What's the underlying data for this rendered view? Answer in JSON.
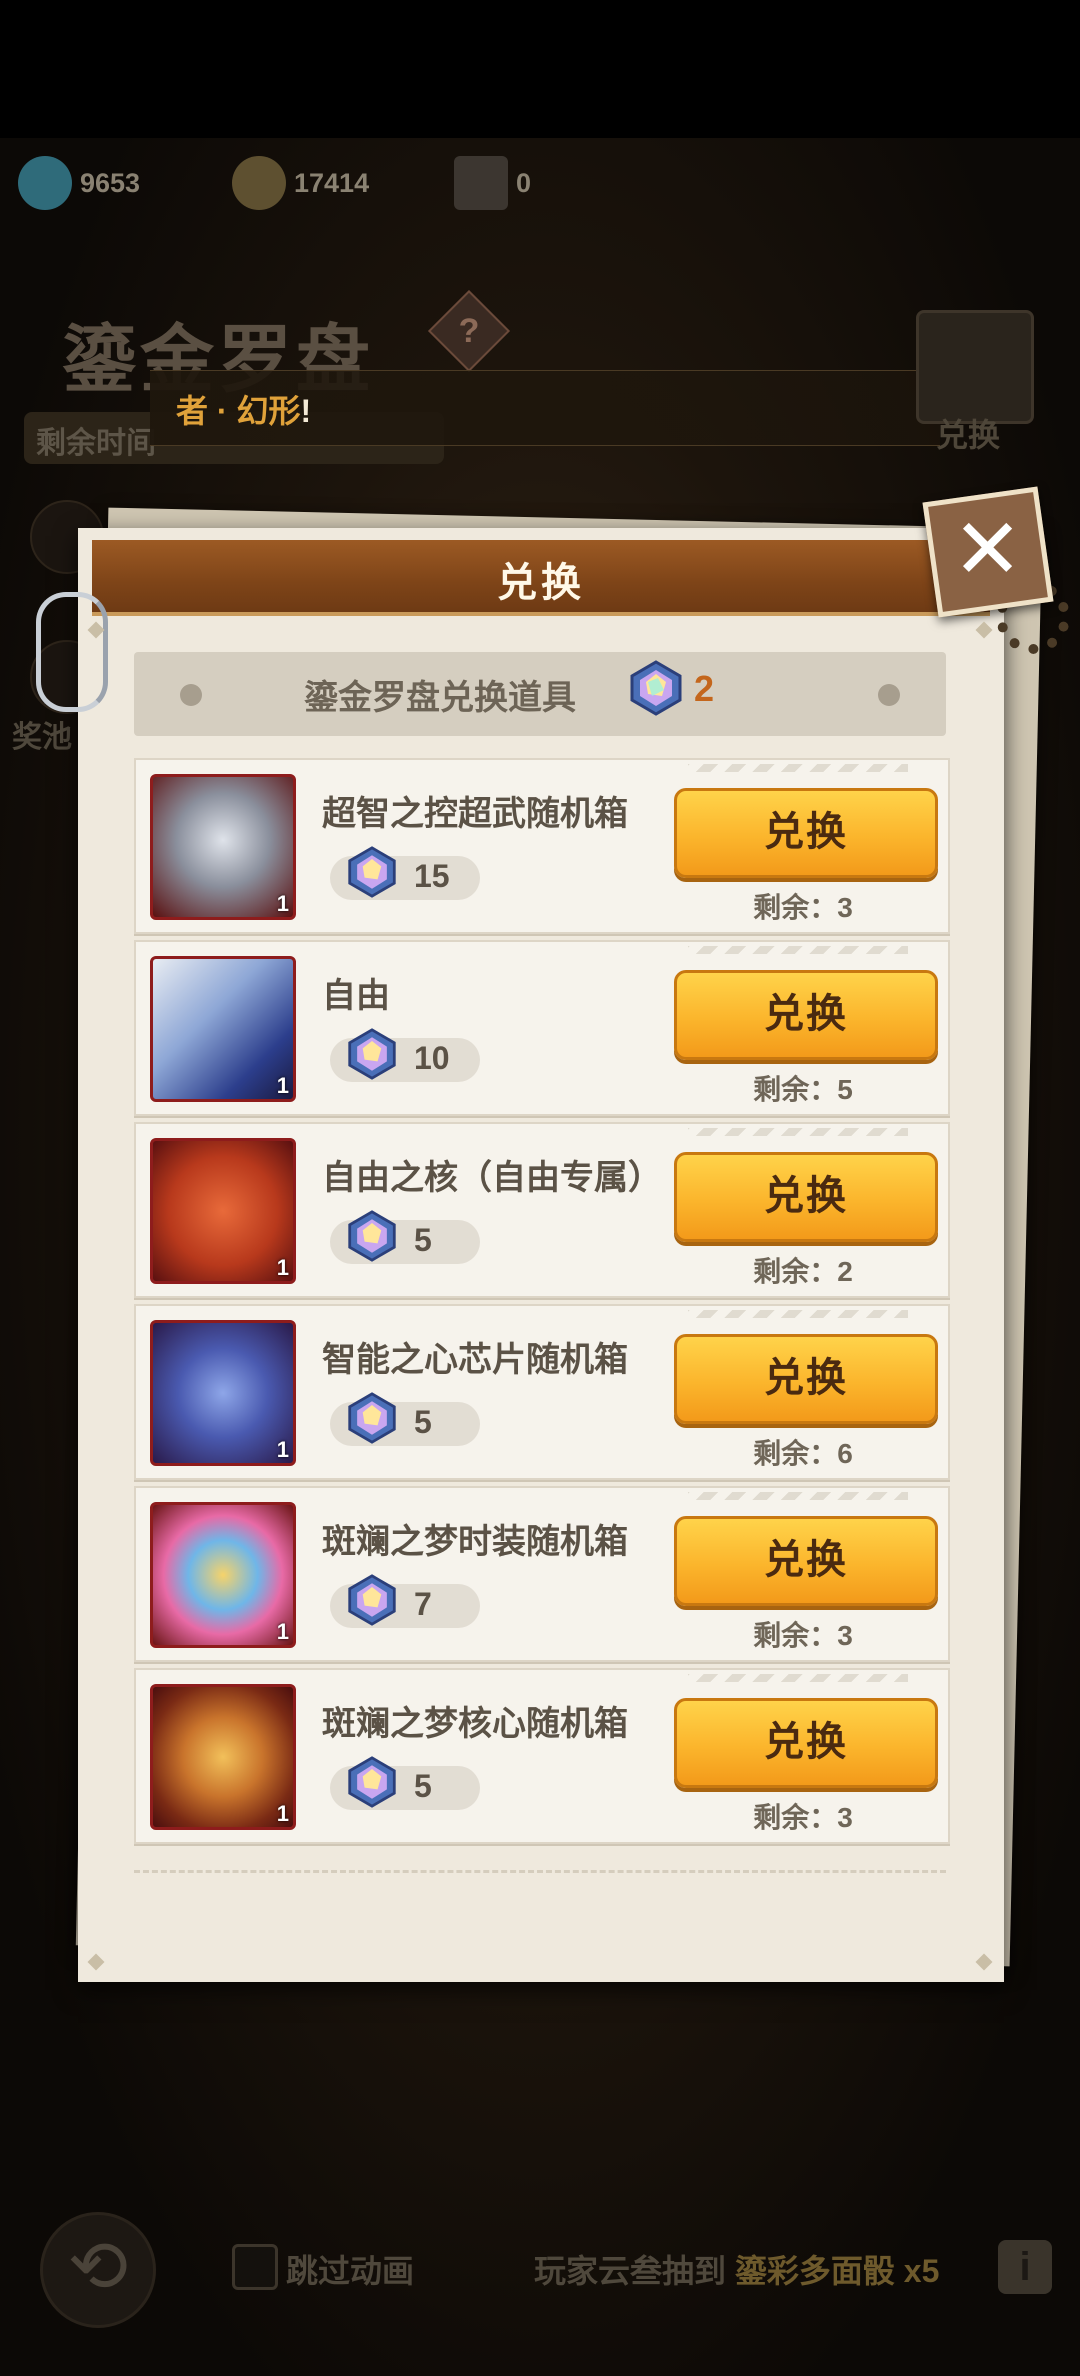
{
  "resources": [
    {
      "icon": "blue-gem-plus-icon",
      "value": "9653"
    },
    {
      "icon": "gold-coin-plus-icon",
      "value": "17414"
    },
    {
      "icon": "wrench-part-icon",
      "value": "0"
    }
  ],
  "background": {
    "event_title": "鎏金罗盘",
    "time_label": "剩余时间",
    "news_prefix": "者 · 幻形",
    "news_suffix": "!",
    "chest_label": "兑换",
    "side_label": "奖池",
    "skip_label": "跳过动画",
    "ticker_prefix": "玩家云叁抽到",
    "ticker_item": "鎏彩多面骰 x5"
  },
  "modal": {
    "title": "兑换",
    "currency_label": "鎏金罗盘兑换道具",
    "currency_count": "2",
    "items": [
      {
        "name": "超智之控超武随机箱",
        "cost": "15",
        "qty": "1",
        "button": "兑换",
        "remain": "剩余：3"
      },
      {
        "name": "自由",
        "cost": "10",
        "qty": "1",
        "button": "兑换",
        "remain": "剩余：5"
      },
      {
        "name": "自由之核（自由专属）",
        "cost": "5",
        "qty": "1",
        "button": "兑换",
        "remain": "剩余：2"
      },
      {
        "name": "智能之心芯片随机箱",
        "cost": "5",
        "qty": "1",
        "button": "兑换",
        "remain": "剩余：6"
      },
      {
        "name": "斑斓之梦时装随机箱",
        "cost": "7",
        "qty": "1",
        "button": "兑换",
        "remain": "剩余：3"
      },
      {
        "name": "斑斓之梦核心随机箱",
        "cost": "5",
        "qty": "1",
        "button": "兑换",
        "remain": "剩余：3"
      }
    ]
  },
  "colors": {
    "accent_button": "#fbb52c",
    "header_brown": "#7e4418",
    "cost_orange": "#c4661c"
  }
}
